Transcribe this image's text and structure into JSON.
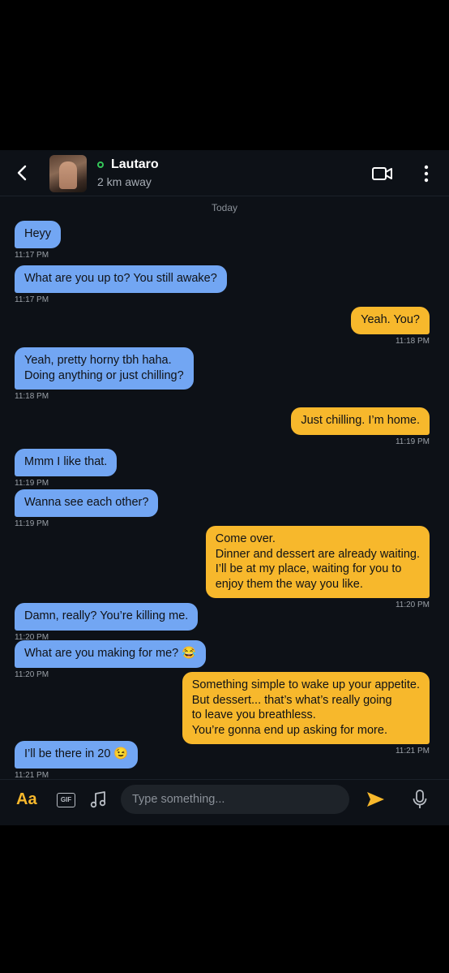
{
  "header": {
    "contact_name": "Lautaro",
    "distance": "2 km away",
    "status": "online",
    "icons": {
      "back": "chevron-left-icon",
      "video": "video-call-icon",
      "more": "more-vertical-icon"
    }
  },
  "date_separator": "Today",
  "messages": [
    {
      "side": "in",
      "text": "Heyy",
      "time": "11:17 PM"
    },
    {
      "side": "in",
      "text": "What are you up to? You still awake?",
      "time": "11:17 PM"
    },
    {
      "side": "out",
      "text": "Yeah. You?",
      "time": "11:18 PM"
    },
    {
      "side": "in",
      "text": "Yeah, pretty horny tbh haha.\nDoing anything or just chilling?",
      "time": "11:18 PM"
    },
    {
      "side": "out",
      "text": "Just chilling. I’m home.",
      "time": "11:19 PM"
    },
    {
      "side": "in",
      "text": "Mmm I like that.",
      "time": "11:19 PM"
    },
    {
      "side": "in",
      "text": "Wanna see each other?",
      "time": "11:19 PM"
    },
    {
      "side": "out",
      "text": "Come over.\nDinner and dessert are already waiting.\nI’ll be at my place, waiting for you to\nenjoy them the way you like.",
      "time": "11:20 PM"
    },
    {
      "side": "in",
      "text": "Damn, really? You’re killing me.",
      "time": "11:20 PM"
    },
    {
      "side": "in",
      "text": "What are you making for me? 😂",
      "time": "11:20 PM"
    },
    {
      "side": "out",
      "text": "Something simple to wake up your appetite.\nBut dessert... that’s what’s really going\nto leave you breathless.\nYou’re gonna end up asking for more.",
      "time": "11:21 PM"
    },
    {
      "side": "in",
      "text": "I’ll be there in 20 😉",
      "time": "11:21 PM"
    }
  ],
  "composer": {
    "format_label": "Aa",
    "gif_label": "GIF",
    "placeholder": "Type something...",
    "icons": {
      "music": "music-note-icon",
      "send": "send-icon",
      "mic": "microphone-icon"
    }
  },
  "colors": {
    "incoming_bubble": "#72a6f3",
    "outgoing_bubble": "#f7b82c",
    "accent": "#f7b82c",
    "background": "#0d1117"
  }
}
